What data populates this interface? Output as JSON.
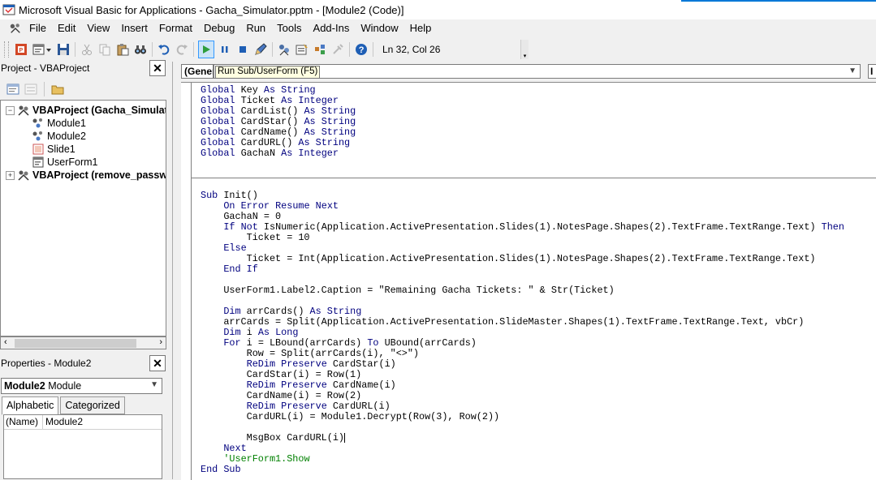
{
  "window": {
    "title": "Microsoft Visual Basic for Applications - Gacha_Simulator.pptm - [Module2 (Code)]"
  },
  "menu": [
    {
      "hot": "F",
      "rest": "ile",
      "name": "menu-file"
    },
    {
      "hot": "E",
      "rest": "dit",
      "name": "menu-edit"
    },
    {
      "hot": "V",
      "rest": "iew",
      "name": "menu-view"
    },
    {
      "hot": "I",
      "rest": "nsert",
      "name": "menu-insert"
    },
    {
      "hot": "F",
      "pre": "",
      "rest": "ormat",
      "name": "menu-format",
      "underline_index": 1
    },
    {
      "hot": "D",
      "rest": "ebug",
      "name": "menu-debug"
    },
    {
      "hot": "R",
      "rest": "un",
      "name": "menu-run"
    },
    {
      "hot": "T",
      "rest": "ools",
      "name": "menu-tools"
    },
    {
      "hot": "A",
      "rest": "dd-Ins",
      "name": "menu-addins"
    },
    {
      "hot": "W",
      "rest": "indow",
      "name": "menu-window"
    },
    {
      "hot": "H",
      "rest": "elp",
      "name": "menu-help"
    }
  ],
  "menu_labels": [
    "File",
    "Edit",
    "View",
    "Insert",
    "Format",
    "Debug",
    "Run",
    "Tools",
    "Add-Ins",
    "Window",
    "Help"
  ],
  "toolbar": {
    "position_label": "Ln 32, Col 26",
    "run_tooltip": "Run Sub/UserForm (F5)"
  },
  "project_pane": {
    "title": "Project - VBAProject",
    "items": [
      {
        "label": "VBAProject (Gacha_Simulator.pptm)",
        "bold": true,
        "expander": "−",
        "icon": "vba-project-icon"
      },
      {
        "label": "Module1",
        "bold": false,
        "icon": "module-icon"
      },
      {
        "label": "Module2",
        "bold": false,
        "icon": "module-icon"
      },
      {
        "label": "Slide1",
        "bold": false,
        "icon": "slide-object-icon"
      },
      {
        "label": "UserForm1",
        "bold": false,
        "icon": "userform-icon"
      },
      {
        "label": "VBAProject (remove_password.pptm)",
        "bold": true,
        "expander": "+",
        "icon": "vba-project-icon"
      }
    ]
  },
  "properties_pane": {
    "title": "Properties - Module2",
    "object_name": "Module2",
    "object_type": "Module",
    "tabs": [
      "Alphabetic",
      "Categorized"
    ],
    "rows": [
      {
        "key": "(Name)",
        "value": "Module2"
      }
    ]
  },
  "code_window": {
    "object_combo": "(General)",
    "procedure_combo": "",
    "far_combo": "I"
  },
  "code": {
    "declarations": [
      "Global Key As String",
      "Global Ticket As Integer",
      "Global CardList() As String",
      "Global CardStar() As String",
      "Global CardName() As String",
      "Global CardURL() As String",
      "Global GachaN As Integer"
    ],
    "procedure": [
      "Sub Init()",
      "    On Error Resume Next",
      "    GachaN = 0",
      "    If Not IsNumeric(Application.ActivePresentation.Slides(1).NotesPage.Shapes(2).TextFrame.TextRange.Text) Then",
      "        Ticket = 10",
      "    Else",
      "        Ticket = Int(Application.ActivePresentation.Slides(1).NotesPage.Shapes(2).TextFrame.TextRange.Text)",
      "    End If",
      "",
      "    UserForm1.Label2.Caption = \"Remaining Gacha Tickets: \" & Str(Ticket)",
      "",
      "    Dim arrCards() As String",
      "    arrCards = Split(Application.ActivePresentation.SlideMaster.Shapes(1).TextFrame.TextRange.Text, vbCr)",
      "    Dim i As Long",
      "    For i = LBound(arrCards) To UBound(arrCards)",
      "        Row = Split(arrCards(i), \"<>\")",
      "        ReDim Preserve CardStar(i)",
      "        CardStar(i) = Row(1)",
      "        ReDim Preserve CardName(i)",
      "        CardName(i) = Row(2)",
      "        ReDim Preserve CardURL(i)",
      "        CardURL(i) = Module1.Decrypt(Row(3), Row(2))",
      "",
      "        MsgBox CardURL(i)",
      "    Next",
      "    'UserForm1.Show",
      "End Sub"
    ]
  }
}
